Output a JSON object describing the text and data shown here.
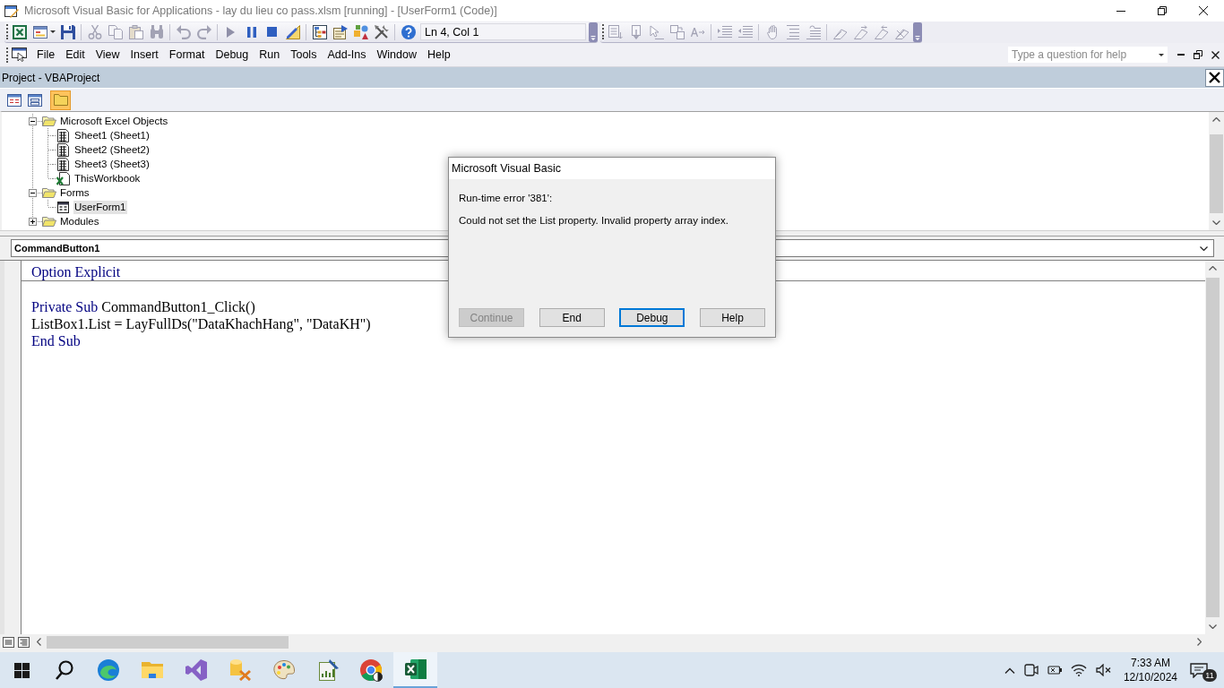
{
  "window": {
    "title": "Microsoft Visual Basic for Applications - lay du lieu co pass.xlsm [running] - [UserForm1 (Code)]"
  },
  "toolbar": {
    "cursor_position": "Ln 4, Col 1"
  },
  "menu": [
    "File",
    "Edit",
    "View",
    "Insert",
    "Format",
    "Debug",
    "Run",
    "Tools",
    "Add-Ins",
    "Window",
    "Help"
  ],
  "help_search": {
    "placeholder": "Type a question for help"
  },
  "project_explorer": {
    "title": "Project - VBAProject",
    "view_buttons": [
      {
        "kind": "code",
        "selected": false
      },
      {
        "kind": "object",
        "selected": false
      },
      {
        "kind": "folders",
        "selected": true
      }
    ],
    "tree": [
      {
        "label": "Microsoft Excel Objects",
        "kind": "folder",
        "expanded": true,
        "selected": false,
        "children": [
          {
            "label": "Sheet1 (Sheet1)",
            "kind": "sheet",
            "selected": false
          },
          {
            "label": "Sheet2 (Sheet2)",
            "kind": "sheet",
            "selected": false
          },
          {
            "label": "Sheet3 (Sheet3)",
            "kind": "sheet",
            "selected": false
          },
          {
            "label": "ThisWorkbook",
            "kind": "workbook",
            "selected": false
          }
        ]
      },
      {
        "label": "Forms",
        "kind": "folder",
        "expanded": true,
        "selected": false,
        "children": [
          {
            "label": "UserForm1",
            "kind": "form",
            "selected": true
          }
        ]
      },
      {
        "label": "Modules",
        "kind": "folder",
        "expanded": false,
        "selected": false
      }
    ]
  },
  "code_window": {
    "object": "CommandButton1",
    "blocks": [
      {
        "lines": [
          [
            {
              "text": "Option Explicit",
              "keyword": true
            }
          ]
        ]
      },
      {
        "lines": [
          [
            {
              "text": "Private Sub",
              "keyword": true
            },
            {
              "text": " CommandButton1_Click()",
              "keyword": false
            }
          ],
          [
            {
              "text": "ListBox1.List = LayFullDs(\"DataKhachHang\", \"DataKH\")",
              "keyword": false
            }
          ],
          [
            {
              "text": "End Sub",
              "keyword": true
            }
          ]
        ]
      }
    ]
  },
  "dialog": {
    "title": "Microsoft Visual Basic",
    "error": "Run-time error '381':",
    "message": "Could not set the List property. Invalid property array index.",
    "buttons": [
      {
        "label": "Continue",
        "disabled": true,
        "focused": false
      },
      {
        "label": "End",
        "disabled": false,
        "focused": false
      },
      {
        "label": "Debug",
        "disabled": false,
        "focused": true
      },
      {
        "label": "Help",
        "disabled": false,
        "focused": false
      }
    ]
  },
  "taskbar": {
    "apps": [
      {
        "kind": "swirl",
        "selected": false
      },
      {
        "kind": "folder",
        "selected": false
      },
      {
        "kind": "ribbon",
        "selected": false
      },
      {
        "kind": "cylinder",
        "selected": false
      },
      {
        "kind": "palette",
        "selected": false
      },
      {
        "kind": "chart-page",
        "selected": false
      },
      {
        "kind": "ring",
        "selected": false
      },
      {
        "kind": "spreadsheet",
        "selected": true
      }
    ],
    "time": "7:33 AM",
    "date": "12/10/2024",
    "notification_count": "11"
  }
}
